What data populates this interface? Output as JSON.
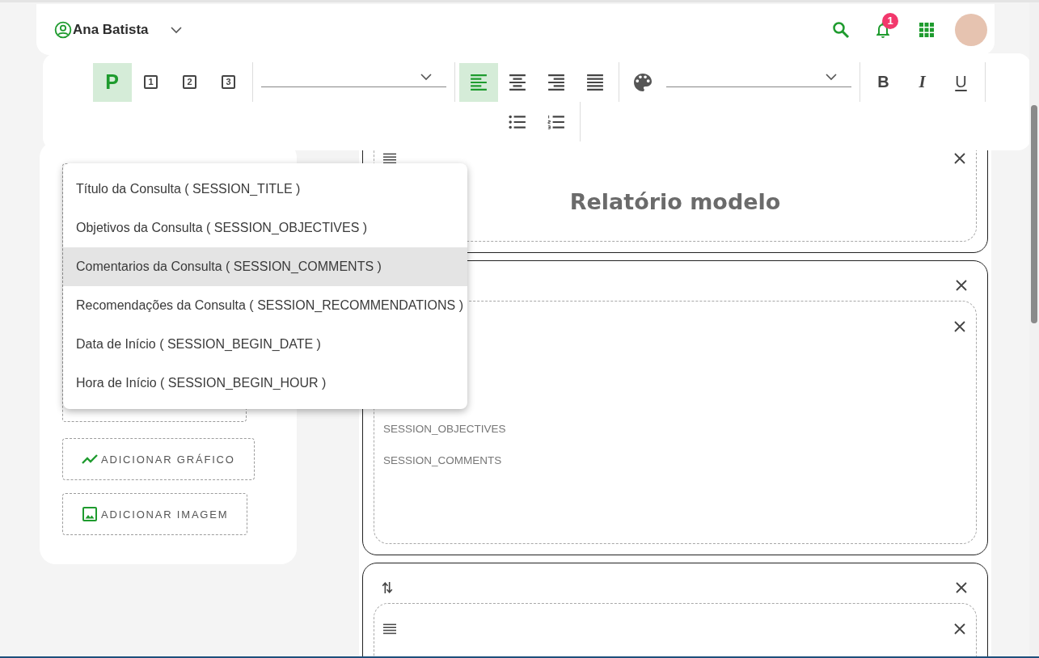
{
  "header": {
    "user": {
      "name": "Ana Batista"
    },
    "notifications": {
      "count": "1"
    }
  },
  "toolbar": {
    "groups": [
      {
        "items": [
          {
            "kind": "paragraph",
            "label": "P",
            "selected": true
          },
          {
            "kind": "heading",
            "label": "1",
            "selected": false
          },
          {
            "kind": "heading",
            "label": "2",
            "selected": false
          },
          {
            "kind": "heading",
            "label": "3",
            "selected": false
          }
        ]
      },
      {
        "items": [
          {
            "kind": "select"
          }
        ]
      },
      {
        "items": [
          {
            "kind": "align_left",
            "selected": true
          },
          {
            "kind": "align_center",
            "selected": false
          },
          {
            "kind": "align_right",
            "selected": false
          },
          {
            "kind": "align_justify",
            "selected": false
          }
        ]
      },
      {
        "items": [
          {
            "kind": "palette",
            "selected": false
          },
          {
            "kind": "select"
          }
        ]
      },
      {
        "items": [
          {
            "kind": "bold",
            "label": "B",
            "selected": false
          },
          {
            "kind": "italic",
            "label": "I",
            "selected": false
          },
          {
            "kind": "underline",
            "label": "U",
            "selected": false
          }
        ]
      },
      {
        "items": [
          {
            "kind": "bullet_list",
            "selected": false
          },
          {
            "kind": "numbered_list",
            "selected": false
          }
        ]
      }
    ]
  },
  "sidebar": {
    "buttons": [
      {
        "kind": "chart",
        "label": "ADICIONAR GRÁFICO"
      },
      {
        "kind": "image",
        "label": "ADICIONAR IMAGEM"
      }
    ]
  },
  "menu": {
    "items": [
      {
        "label": "Título da Consulta ( SESSION_TITLE )",
        "highlighted": false
      },
      {
        "label": "Objetivos da Consulta ( SESSION_OBJECTIVES )",
        "highlighted": false
      },
      {
        "label": "Comentarios da Consulta ( SESSION_COMMENTS )",
        "highlighted": true
      },
      {
        "label": "Recomendações da Consulta ( SESSION_RECOMMENDATIONS )",
        "highlighted": false
      },
      {
        "label": "Data de Início ( SESSION_BEGIN_DATE )",
        "highlighted": false
      },
      {
        "label": "Hora de Início ( SESSION_BEGIN_HOUR )",
        "highlighted": false
      }
    ]
  },
  "editor": {
    "blocks": [
      {
        "section": {
          "controls": [
            {
              "kind": "lines"
            },
            {
              "kind": "close"
            }
          ],
          "kind": "heading",
          "text": "Relatório modelo"
        }
      },
      {
        "controls": [
          {
            "kind": "close"
          }
        ],
        "section": {
          "controls": [
            {
              "kind": "close"
            }
          ],
          "kind": "fields",
          "fields": [
            "SESSION_OBJECTIVES",
            "SESSION_COMMENTS"
          ]
        }
      },
      {
        "controls": [
          {
            "kind": "move"
          },
          {
            "kind": "close"
          }
        ],
        "section": {
          "controls": [
            {
              "kind": "lines"
            },
            {
              "kind": "close"
            }
          ]
        }
      }
    ]
  }
}
